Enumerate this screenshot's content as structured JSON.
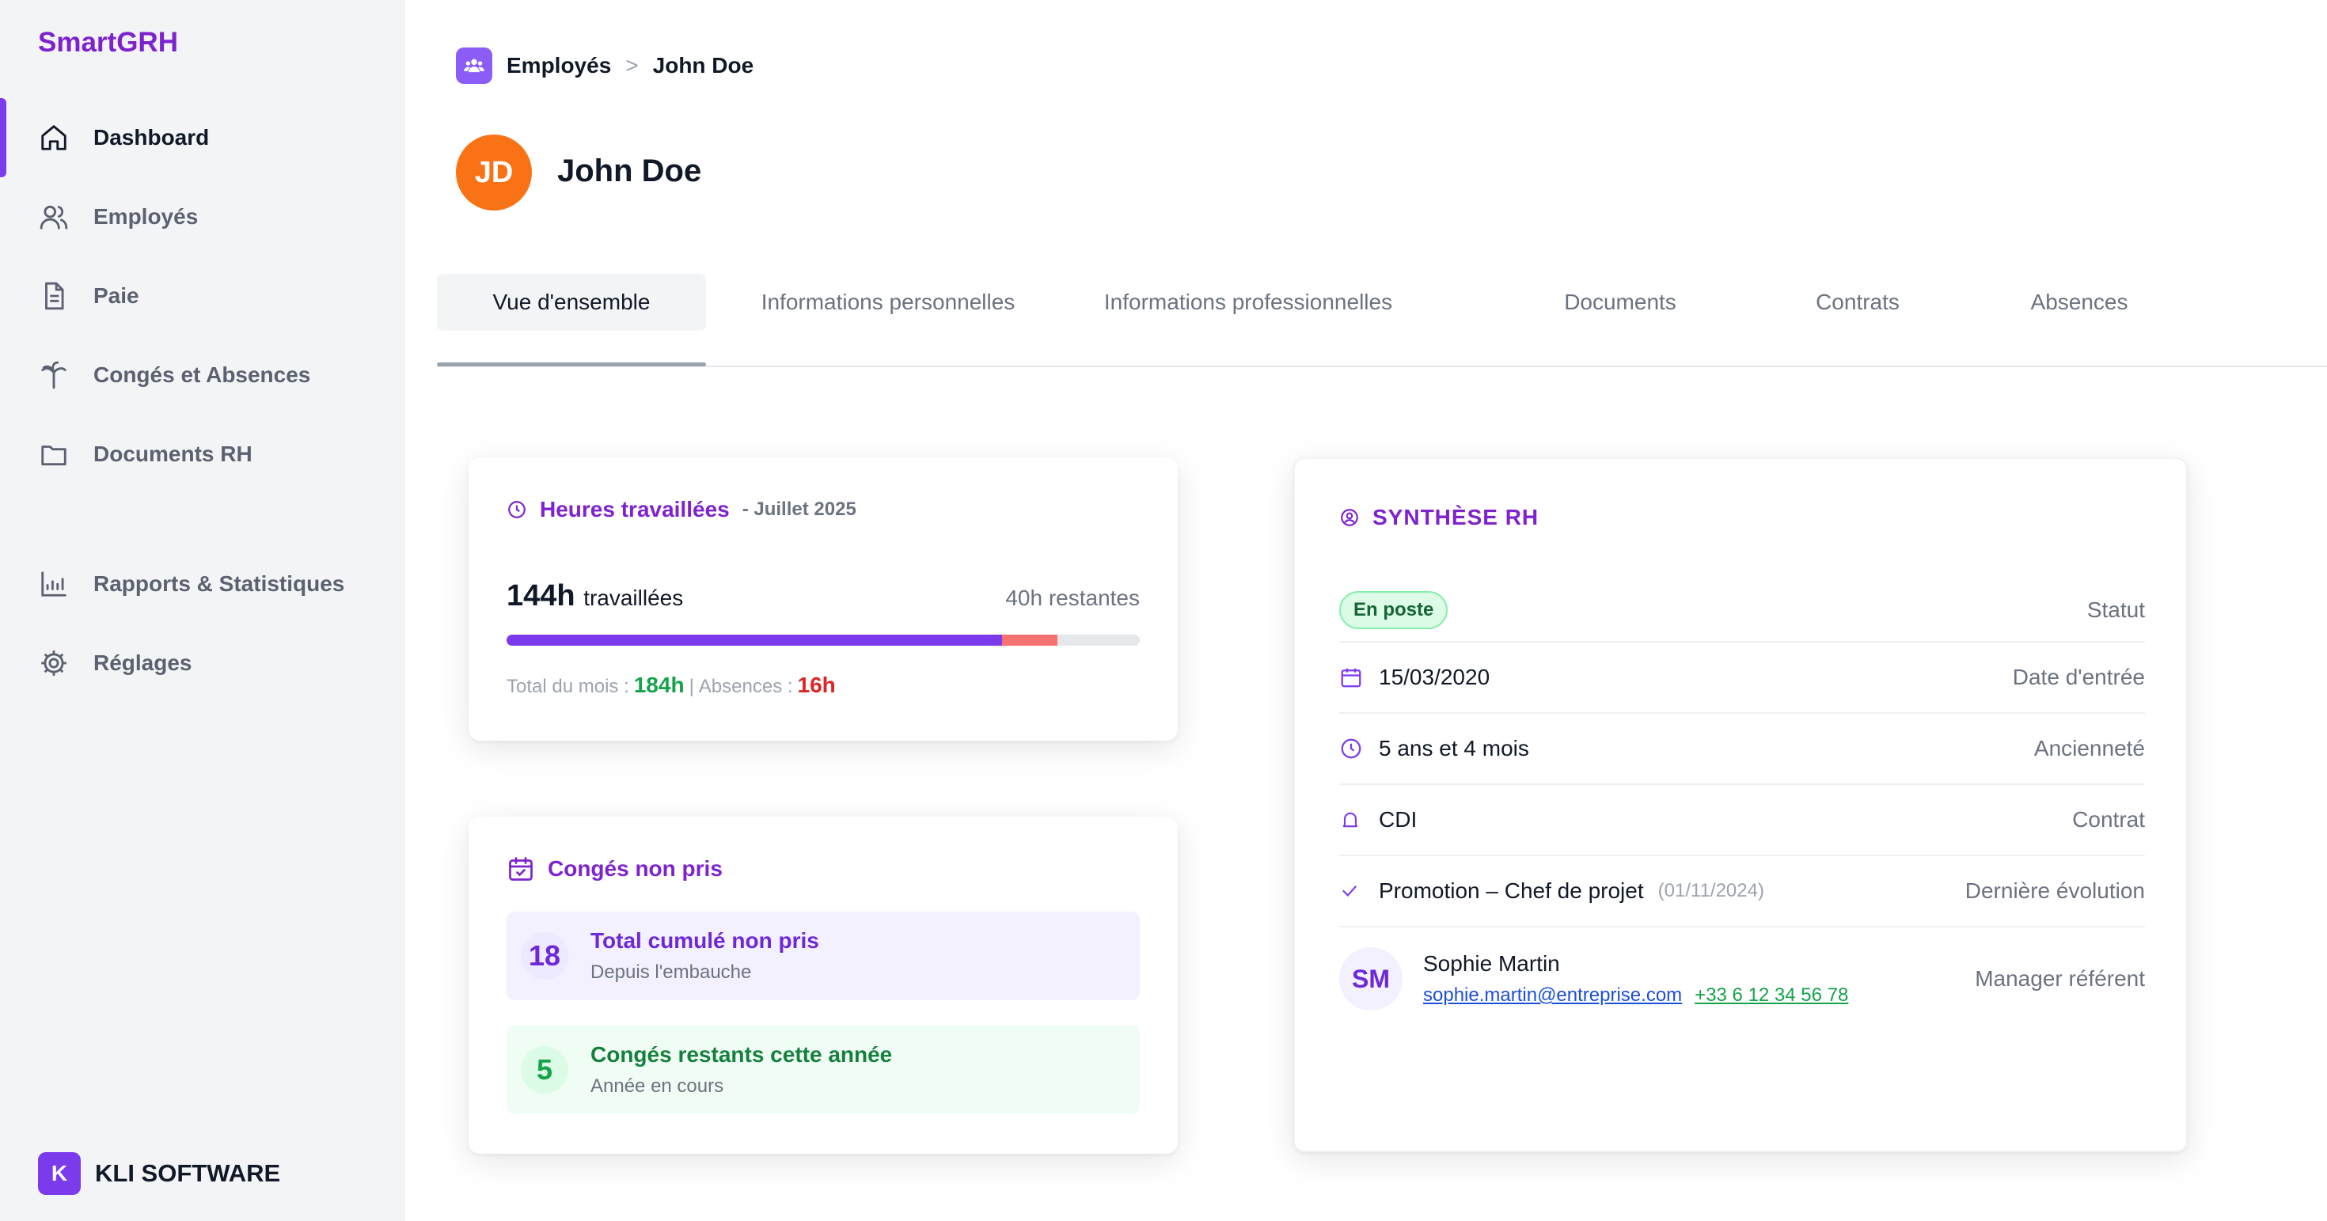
{
  "app": {
    "name": "SmartGRH"
  },
  "sidebar": {
    "items": [
      {
        "label": "Dashboard",
        "icon": "home-icon"
      },
      {
        "label": "Employés",
        "icon": "users-icon"
      },
      {
        "label": "Paie",
        "icon": "document-icon"
      },
      {
        "label": "Congés et Absences",
        "icon": "palm-tree-icon"
      },
      {
        "label": "Documents RH",
        "icon": "folder-icon"
      },
      {
        "label": "Rapports & Statistiques",
        "icon": "chart-icon"
      },
      {
        "label": "Réglages",
        "icon": "gear-icon"
      }
    ],
    "footer": {
      "logo_letter": "K",
      "company": "KLI SOFTWARE"
    }
  },
  "breadcrumb": {
    "parent": "Employés",
    "separator": ">",
    "current": "John Doe"
  },
  "employee": {
    "initials": "JD",
    "name": "John Doe"
  },
  "tabs": [
    {
      "label": "Vue d'ensemble"
    },
    {
      "label": "Informations personnelles"
    },
    {
      "label": "Informations professionnelles"
    },
    {
      "label": "Documents"
    },
    {
      "label": "Contrats"
    },
    {
      "label": "Absences"
    }
  ],
  "hours_card": {
    "title": "Heures travaillées",
    "period": "- Juillet 2025",
    "worked_value": "144h",
    "worked_label": "travaillées",
    "remaining": "40h restantes",
    "total_label": "Total du mois :",
    "total_value": "184h",
    "separator": "|",
    "absences_label": "Absences :",
    "absences_value": "16h",
    "progress": {
      "worked_fraction": 0.783,
      "absence_fraction": 0.087
    },
    "colors": {
      "worked": "#7c3aed",
      "absence": "#f87171",
      "track": "#e5e7eb"
    }
  },
  "leave_card": {
    "title": "Congés non pris",
    "rows": [
      {
        "value": "18",
        "title": "Total cumulé non pris",
        "subtitle": "Depuis l'embauche"
      },
      {
        "value": "5",
        "title": "Congés restants cette année",
        "subtitle": "Année en cours"
      }
    ]
  },
  "hr_card": {
    "title": "SYNTHÈSE RH",
    "status": {
      "badge": "En poste",
      "label": "Statut"
    },
    "entry_date": {
      "value": "15/03/2020",
      "label": "Date d'entrée"
    },
    "seniority": {
      "value": "5 ans et 4 mois",
      "label": "Ancienneté"
    },
    "contract": {
      "value": "CDI",
      "label": "Contrat"
    },
    "evolution": {
      "value": "Promotion – Chef de projet",
      "date": "(01/11/2024)",
      "label": "Dernière évolution"
    },
    "manager": {
      "initials": "SM",
      "name": "Sophie Martin",
      "email": "sophie.martin@entreprise.com",
      "phone": "+33 6 12 34 56 78",
      "label": "Manager référent"
    }
  },
  "colors": {
    "accent": "#7c3aed",
    "brand_text": "#7e22ce",
    "avatar": "#f97316",
    "success": "#16a34a",
    "danger": "#dc2626"
  }
}
